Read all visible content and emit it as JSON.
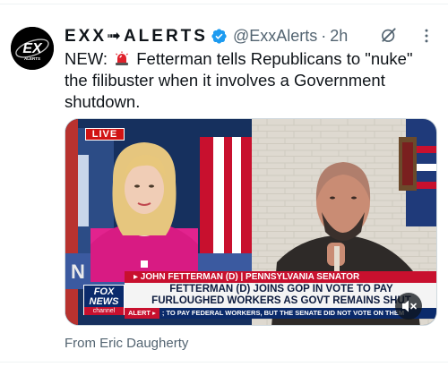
{
  "tweet": {
    "author_name": "EXX➟ALERTS",
    "handle": "@ExxAlerts",
    "separator": "·",
    "timestamp": "2h",
    "verified": true,
    "text_prefix": "NEW:",
    "text_body": "Fetterman tells Republicans to \"nuke\" the filibuster when it involves a Government shutdown.",
    "siren_icon": "police-siren-emoji",
    "avatar_logo_text": "EX",
    "avatar_sub_text": "ALERTS",
    "accent_color": "#1d9bf0"
  },
  "media": {
    "live_label": "LIVE",
    "chyron_name": "▸ JOHN FETTERMAN (D) | PENNSYLVANIA SENATOR",
    "headline_line1": "FETTERMAN (D) JOINS GOP IN VOTE TO PAY",
    "headline_line2": "FURLOUGHED WORKERS AS GOVT REMAINS SHUT",
    "network_line1": "FOX",
    "network_line2": "NEWS",
    "network_line3": "channel",
    "ticker_label": "ALERT ▸",
    "ticker_text": "; TO PAY FEDERAL WORKERS, BUT THE SENATE DID NOT VOTE ON THEM",
    "mute_icon": "speaker-muted-icon"
  },
  "attribution": {
    "text": "From Eric Daugherty"
  }
}
